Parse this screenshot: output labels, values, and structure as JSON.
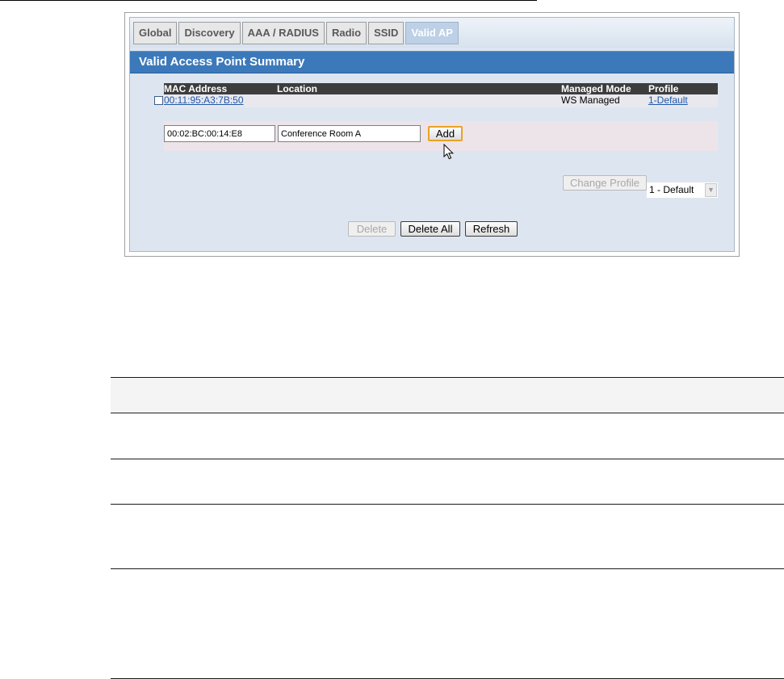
{
  "tabs": [
    {
      "label": "Global",
      "active": false
    },
    {
      "label": "Discovery",
      "active": false
    },
    {
      "label": "AAA / RADIUS",
      "active": false
    },
    {
      "label": "Radio",
      "active": false
    },
    {
      "label": "SSID",
      "active": false
    },
    {
      "label": "Valid AP",
      "active": true
    }
  ],
  "page_title": "Valid Access Point Summary",
  "table": {
    "headers": {
      "mac": "MAC Address",
      "location": "Location",
      "mode": "Managed Mode",
      "profile": "Profile"
    },
    "rows": [
      {
        "mac": "00:11:95:A3:7B:50",
        "location": "",
        "mode": "WS Managed",
        "profile": "1-Default",
        "checked": false
      }
    ]
  },
  "add_form": {
    "mac_value": "00:02:BC:00:14:E8",
    "location_value": "Conference Room A",
    "add_label": "Add"
  },
  "profile_controls": {
    "change_profile_label": "Change Profile",
    "profile_select_value": "1 - Default"
  },
  "bottom_buttons": {
    "delete_label": "Delete",
    "delete_all_label": "Delete All",
    "refresh_label": "Refresh"
  },
  "colors": {
    "title_bar": "#3c79ba",
    "active_tab": "#bdd0e5",
    "link": "#1f58a8",
    "focus_ring": "#e7a326"
  },
  "icons": {
    "select_arrow": "chevron-down-icon",
    "cursor": "mouse-pointer-icon"
  }
}
